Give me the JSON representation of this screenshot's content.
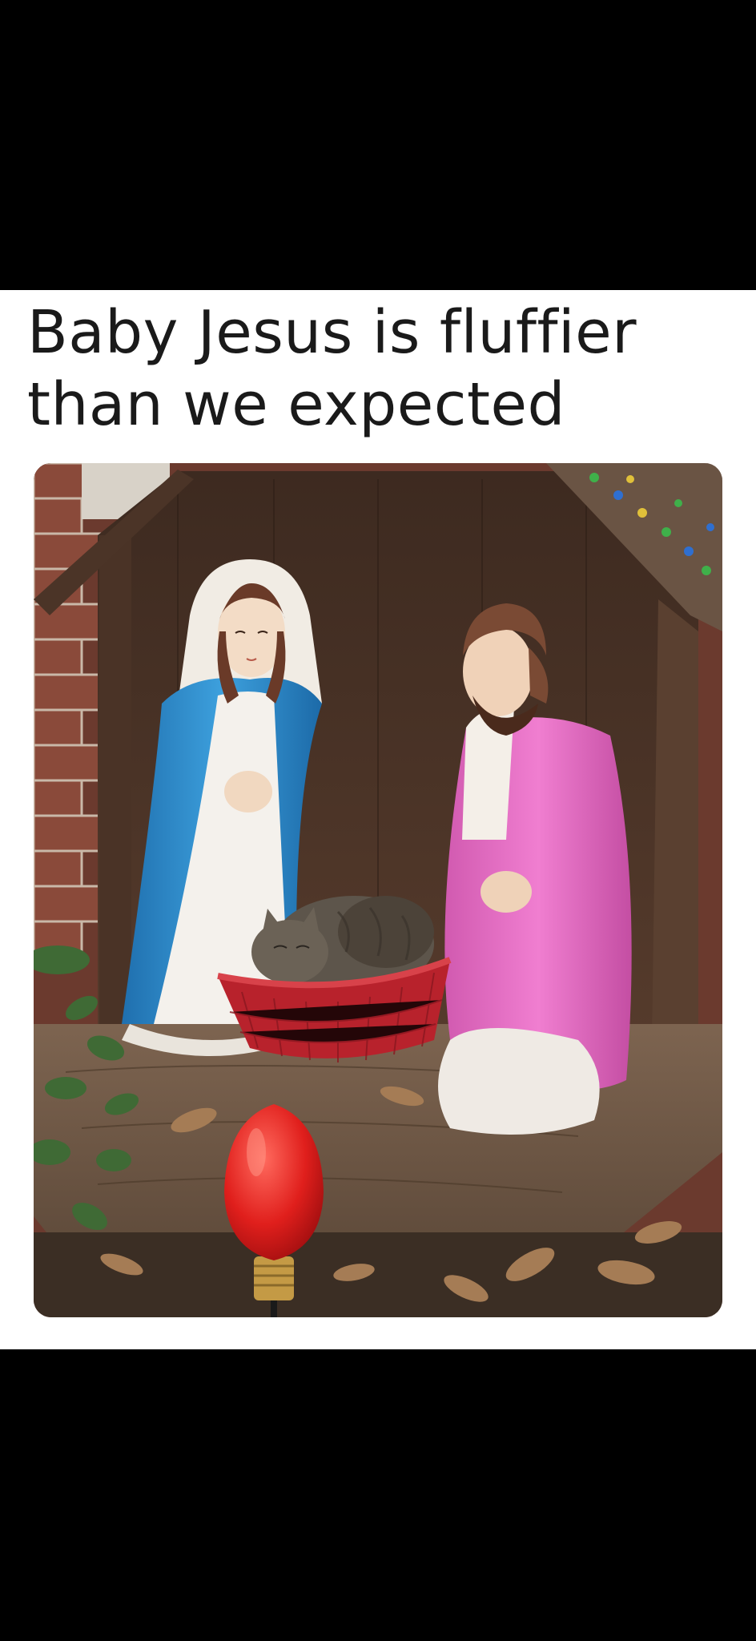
{
  "caption": {
    "line1": "Baby Jesus is fluffier",
    "line2": "than we expected"
  },
  "photo": {
    "subject": "nativity-scene-with-cat"
  },
  "colors": {
    "background_bars": "#000000",
    "card": "#ffffff",
    "text": "#1a1a1a",
    "mary_robe": "#2f8fd0",
    "joseph_robe": "#e56fc4",
    "basket": "#b8222c",
    "bulb": "#e0201e"
  }
}
